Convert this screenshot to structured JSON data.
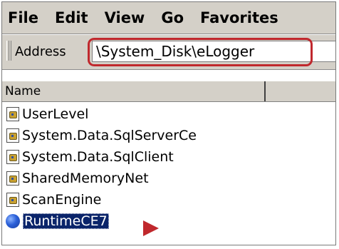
{
  "menubar": {
    "items": [
      {
        "label": "File"
      },
      {
        "label": "Edit"
      },
      {
        "label": "View"
      },
      {
        "label": "Go"
      },
      {
        "label": "Favorites"
      }
    ]
  },
  "addressbar": {
    "label": "Address",
    "value": "\\System_Disk\\eLogger"
  },
  "list": {
    "column_header": "Name",
    "items": [
      {
        "label": "UserLevel",
        "icon": "dll-file-icon"
      },
      {
        "label": "System.Data.SqlServerCe",
        "icon": "dll-file-icon"
      },
      {
        "label": "System.Data.SqlClient",
        "icon": "dll-file-icon"
      },
      {
        "label": "SharedMemoryNet",
        "icon": "dll-file-icon"
      },
      {
        "label": "ScanEngine",
        "icon": "dll-file-icon"
      },
      {
        "label": "RuntimeCE7",
        "icon": "globe-icon",
        "selected": true
      }
    ]
  },
  "colors": {
    "highlight": "#c0282d",
    "selection": "#0a246a",
    "chrome": "#d4d0c8"
  }
}
